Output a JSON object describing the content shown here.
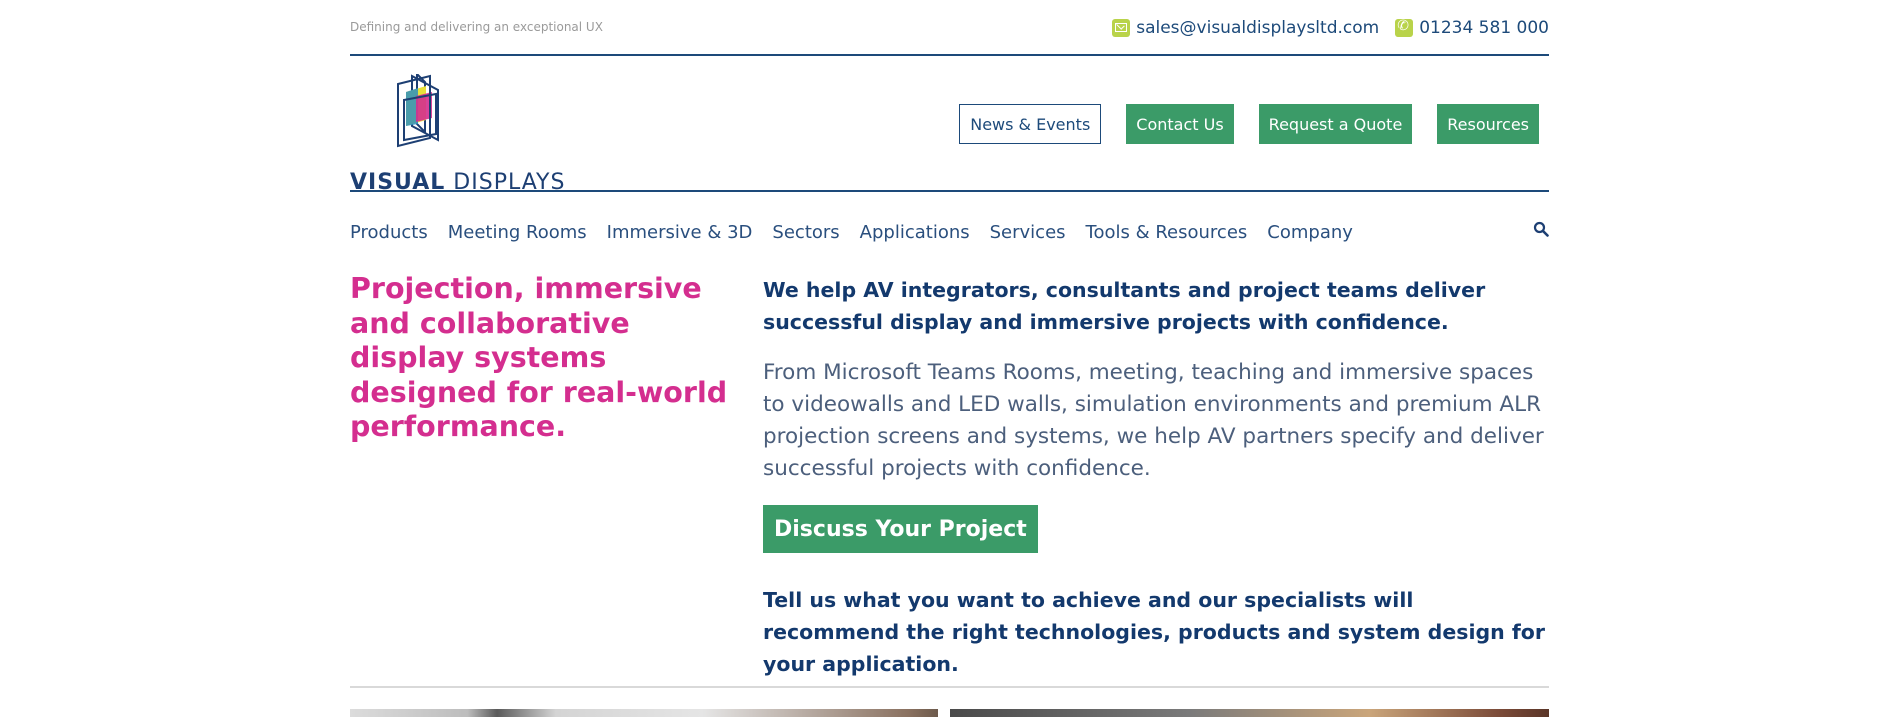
{
  "topbar": {
    "tagline": "Defining and delivering an exceptional UX",
    "email": "sales@visualdisplaysltd.com",
    "phone": "01234 581 000",
    "email_icon": "mail-icon",
    "phone_icon": "phone-icon"
  },
  "brand": {
    "name_bold": "VISUAL",
    "name_regular": "DISPLAYS",
    "colors": {
      "navy": "#1d3f73",
      "magenta": "#d42e8f",
      "green": "#3b9b68",
      "lime": "#b9d34a",
      "yellow": "#e8e23a"
    }
  },
  "header_buttons": [
    {
      "label": "News & Events",
      "style": "outline"
    },
    {
      "label": "Contact Us",
      "style": "filled"
    },
    {
      "label": "Request a Quote",
      "style": "filled"
    },
    {
      "label": "Resources",
      "style": "filled"
    }
  ],
  "nav": {
    "items": [
      "Products",
      "Meeting Rooms",
      "Immersive & 3D",
      "Sectors",
      "Applications",
      "Services",
      "Tools & Resources",
      "Company"
    ],
    "search_icon": "search-icon"
  },
  "hero": {
    "headline": "Projection, immersive and collaborative display systems designed for real-world performance.",
    "lead": "We help AV integrators, consultants and project teams deliver successful display and immersive projects with confidence.",
    "paragraph": "From Microsoft Teams Rooms, meeting, teaching and immersive spaces to videowalls and LED walls, simulation environments and premium ALR projection screens and systems, we help AV partners specify and deliver successful projects with confidence.",
    "cta_label": "Discuss Your Project",
    "note": "Tell us what you want to achieve and our specialists will recommend the right technologies, products and system design for your application."
  }
}
